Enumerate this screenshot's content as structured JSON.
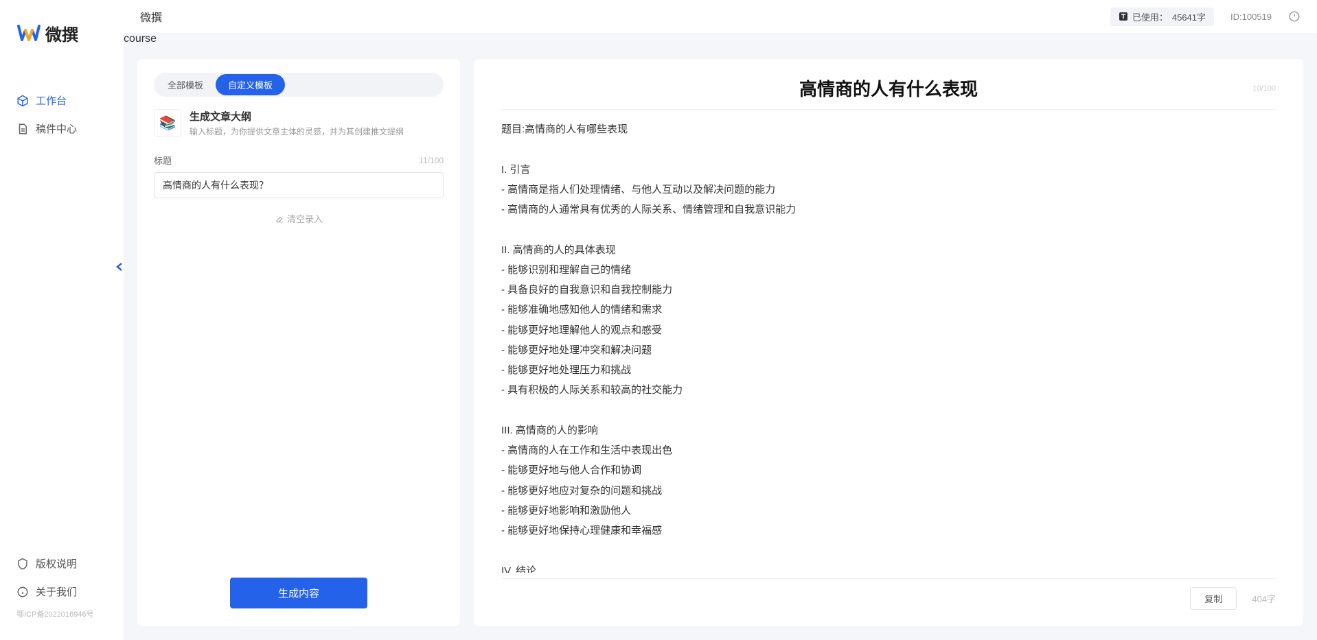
{
  "app": {
    "name": "微撰",
    "topbar_title": "微撰"
  },
  "sidebar": {
    "nav": [
      {
        "label": "工作台",
        "active": true
      },
      {
        "label": "稿件中心",
        "active": false
      }
    ],
    "footer": [
      {
        "label": "版权说明"
      },
      {
        "label": "关于我们"
      }
    ],
    "icp": "鄂ICP备2022016946号"
  },
  "topbar": {
    "usage_prefix": "已使用：",
    "usage_value": "45641字",
    "id_label": "ID:100519"
  },
  "left_panel": {
    "tabs": [
      {
        "label": "全部模板",
        "active": false
      },
      {
        "label": "自定义模板",
        "active": true
      }
    ],
    "template": {
      "name": "生成文章大纲",
      "desc": "输入标题，为你提供文章主体的灵感，并为其创建推文提纲"
    },
    "field": {
      "label": "标题",
      "counter": "11/100",
      "value": "高情商的人有什么表现？"
    },
    "clear_label": "清空录入",
    "generate_label": "生成内容"
  },
  "right_panel": {
    "title": "高情商的人有什么表现",
    "title_counter": "10/100",
    "body": "题目:高情商的人有哪些表现\n\nI. 引言\n- 高情商是指人们处理情绪、与他人互动以及解决问题的能力\n- 高情商的人通常具有优秀的人际关系、情绪管理和自我意识能力\n\nII. 高情商的人的具体表现\n- 能够识别和理解自己的情绪\n- 具备良好的自我意识和自我控制能力\n- 能够准确地感知他人的情绪和需求\n- 能够更好地理解他人的观点和感受\n- 能够更好地处理冲突和解决问题\n- 能够更好地处理压力和挑战\n- 具有积极的人际关系和较高的社交能力\n\nIII. 高情商的人的影响\n- 高情商的人在工作和生活中表现出色\n- 能够更好地与他人合作和协调\n- 能够更好地应对复杂的问题和挑战\n- 能够更好地影响和激励他人\n- 能够更好地保持心理健康和幸福感\n\nIV. 结论\n- 高情商的人具有广泛的负面影响和积极影响\n- 高情商的能力是可以通过学习和练习获得的\n- 培养和提高高情商的能力对于个人的职业发展和生活质量至关重要。",
    "copy_label": "复制",
    "word_count": "404字"
  }
}
